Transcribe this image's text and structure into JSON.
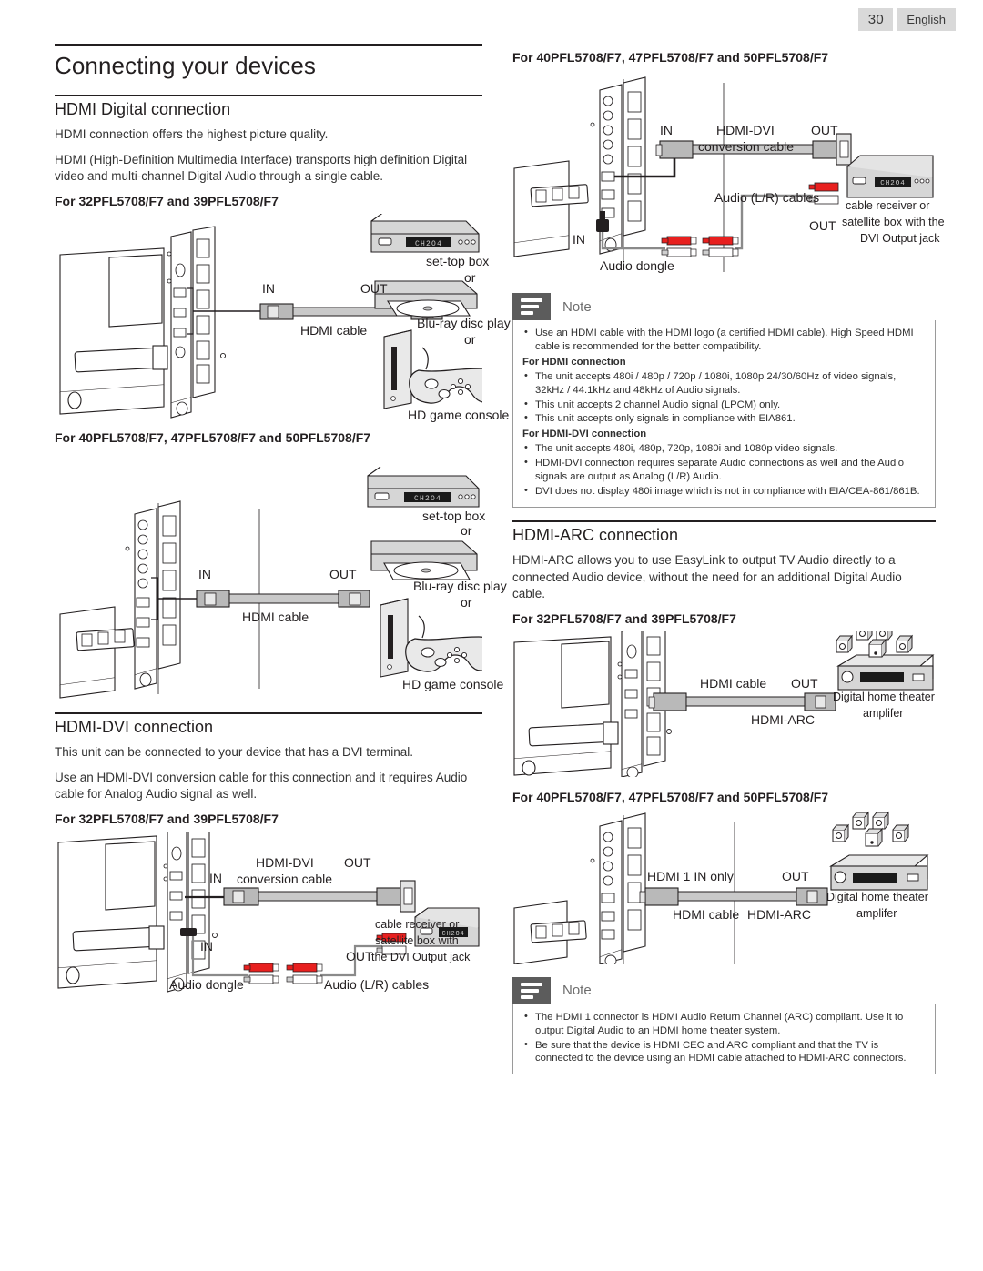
{
  "header": {
    "page_number": "30",
    "language": "English"
  },
  "left": {
    "doc_title": "Connecting your devices",
    "hdmi_digital": {
      "title": "HDMI Digital connection",
      "p1": "HDMI connection offers the highest picture quality.",
      "p2": "HDMI (High-Definition Multimedia Interface) transports high definition Digital video and multi-channel Digital Audio through a single cable.",
      "model_a": "For 32PFL5708/F7 and 39PFL5708/F7",
      "model_b": "For 40PFL5708/F7, 47PFL5708/F7 and 50PFL5708/F7",
      "labels": {
        "in": "IN",
        "out": "OUT",
        "cable": "HDMI cable",
        "set_top_box": "set-top box",
        "or1": "or",
        "bluray": "Blu-ray disc play",
        "or2": "or",
        "game": "HD game console",
        "display_text": "CH 2 04"
      }
    },
    "hdmi_dvi": {
      "title": "HDMI-DVI connection",
      "p1": "This unit can be connected to your device that has a DVI terminal.",
      "p2": "Use an HDMI-DVI conversion cable for this connection and it requires Audio cable for Analog Audio signal as well.",
      "model_a": "For 32PFL5708/F7 and 39PFL5708/F7",
      "labels": {
        "in1": "IN",
        "in2": "IN",
        "out1": "OUT",
        "out2": "OUT",
        "conv_l1": "HDMI-DVI",
        "conv_l2": "conversion cable",
        "audio_dongle": "Audio dongle",
        "audio_lr": "Audio (L/R) cables",
        "device_l1": "cable receiver or",
        "device_l2": "satellite box with",
        "device_l3": "the DVI Output jack",
        "display_text": "CH 2 04"
      }
    }
  },
  "right": {
    "hdmi_dvi_big": {
      "model_b": "For 40PFL5708/F7, 47PFL5708/F7 and 50PFL5708/F7",
      "labels": {
        "in1": "IN",
        "in2": "IN",
        "out1": "OUT",
        "out2": "OUT",
        "conv_l1": "HDMI-DVI",
        "conv_l2": "conversion cable",
        "audio_lr": "Audio (L/R) cables",
        "audio_dongle": "Audio dongle",
        "device_l1": "cable receiver or",
        "device_l2": "satellite box with the",
        "device_l3": "DVI Output jack",
        "display_text": "CH 2 04"
      }
    },
    "note1": {
      "title": "Note",
      "items": [
        {
          "type": "bullet",
          "text": "Use an HDMI cable with the HDMI logo (a certified HDMI cable). High Speed HDMI cable is recommended for the better compatibility."
        },
        {
          "type": "subhead",
          "text": "For HDMI connection"
        },
        {
          "type": "bullet",
          "text": "The unit accepts 480i / 480p / 720p / 1080i, 1080p 24/30/60Hz of video signals, 32kHz / 44.1kHz and 48kHz of Audio signals."
        },
        {
          "type": "bullet",
          "text": "This unit accepts 2 channel Audio signal (LPCM) only."
        },
        {
          "type": "bullet",
          "text": "This unit accepts only signals in compliance with EIA861."
        },
        {
          "type": "subhead",
          "text": "For HDMI-DVI connection"
        },
        {
          "type": "bullet",
          "text": "The unit accepts 480i, 480p, 720p, 1080i and 1080p video signals."
        },
        {
          "type": "bullet",
          "text": "HDMI-DVI connection requires separate Audio connections as well and the Audio signals are output as Analog (L/R) Audio."
        },
        {
          "type": "bullet",
          "text": "DVI does not display 480i image which is not in compliance with EIA/CEA-861/861B."
        }
      ]
    },
    "hdmi_arc": {
      "title": "HDMI-ARC connection",
      "p1": "HDMI-ARC allows you to use EasyLink to output TV Audio directly to a connected Audio device, without the need for an additional Digital Audio cable.",
      "model_a": "For 32PFL5708/F7 and 39PFL5708/F7",
      "model_b": "For 40PFL5708/F7, 47PFL5708/F7 and 50PFL5708/F7",
      "labels_a": {
        "cable": "HDMI cable",
        "out": "OUT",
        "arc": "HDMI-ARC",
        "amp_l1": "Digital home theater",
        "amp_l2": "amplifer"
      },
      "labels_b": {
        "in_only": "HDMI 1 IN only",
        "out": "OUT",
        "cable": "HDMI cable",
        "arc": "HDMI-ARC",
        "amp_l1": "Digital home theater",
        "amp_l2": "amplifer"
      }
    },
    "note2": {
      "title": "Note",
      "items": [
        {
          "type": "bullet",
          "text": "The HDMI 1 connector is HDMI Audio Return Channel (ARC) compliant. Use it to output Digital Audio to an HDMI home theater system."
        },
        {
          "type": "bullet",
          "text": "Be sure that the device is HDMI CEC and ARC compliant and that the TV is connected to the device using an HDMI cable attached to HDMI-ARC connectors."
        }
      ]
    }
  },
  "colors": {
    "ink": "#231f20",
    "note_icon_bg": "#5c5c5c",
    "badge_bg": "#d9d9d9",
    "rca_red": "#e8201f",
    "device_gray": "#d3d3d3",
    "cable_gray": "#c9c9c9"
  }
}
